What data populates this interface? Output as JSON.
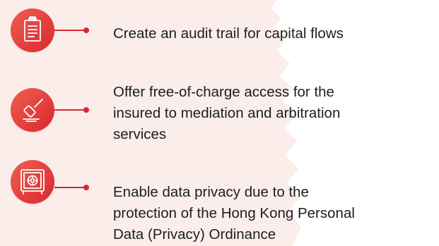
{
  "colors": {
    "accent": "#d9272e",
    "accent_light": "#ef5f50",
    "background_tint": "#fbeeea",
    "text": "#1e1e1e"
  },
  "features": [
    {
      "icon": "clipboard-icon",
      "lines": [
        "Create an audit trail for capital flows"
      ]
    },
    {
      "icon": "gavel-icon",
      "lines": [
        "Offer free-of-charge access for the",
        "insured to mediation and arbitration",
        "services"
      ]
    },
    {
      "icon": "safe-icon",
      "lines": [
        "Enable data privacy due to the",
        "protection of the Hong Kong Personal",
        "Data (Privacy) Ordinance"
      ]
    }
  ]
}
